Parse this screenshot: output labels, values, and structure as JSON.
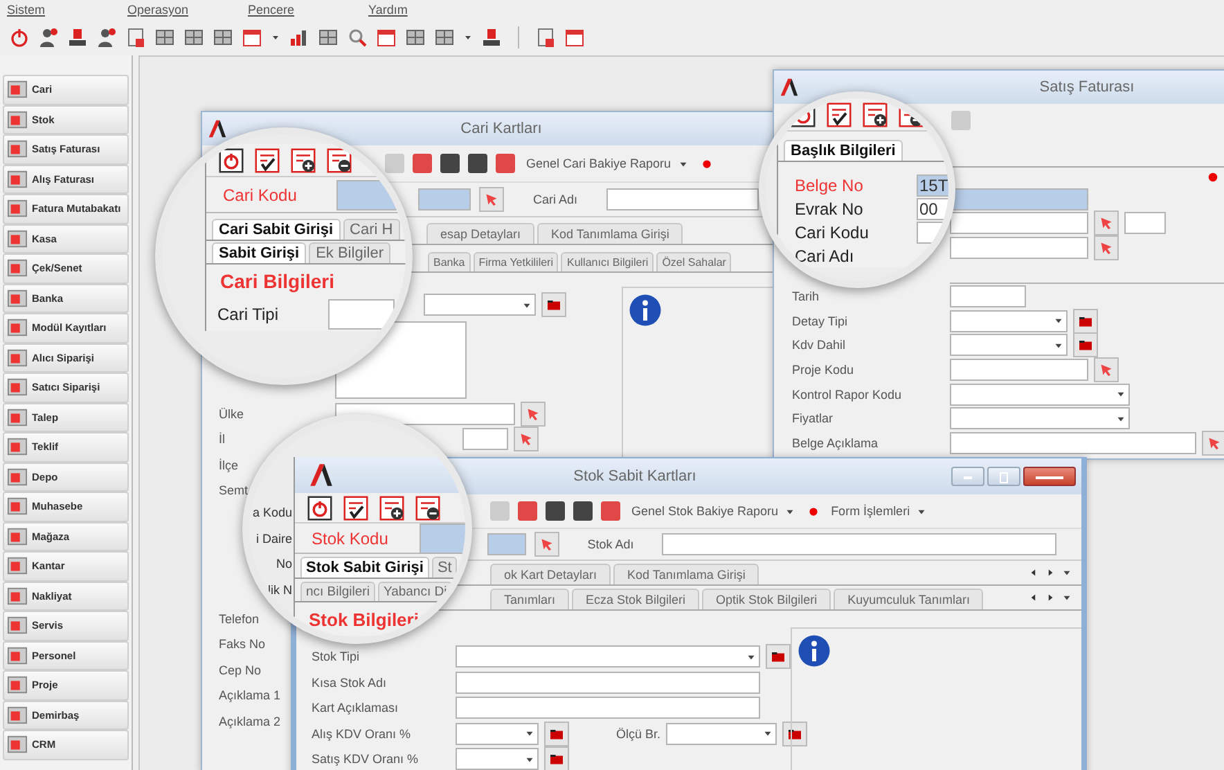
{
  "menu": [
    {
      "label": "Sistem"
    },
    {
      "label": "Operasyon"
    },
    {
      "label": "Pencere"
    },
    {
      "label": "Yardım"
    }
  ],
  "sidebar": {
    "items": [
      {
        "label": "Cari"
      },
      {
        "label": "Stok"
      },
      {
        "label": "Satış Faturası"
      },
      {
        "label": "Alış Faturası"
      },
      {
        "label": "Fatura Mutabakatı"
      },
      {
        "label": "Kasa"
      },
      {
        "label": "Çek/Senet"
      },
      {
        "label": "Banka"
      },
      {
        "label": "Modül Kayıtları"
      },
      {
        "label": "Alıcı Siparişi"
      },
      {
        "label": "Satıcı Siparişi"
      },
      {
        "label": "Talep"
      },
      {
        "label": "Teklif"
      },
      {
        "label": "Depo"
      },
      {
        "label": "Muhasebe"
      },
      {
        "label": "Mağaza"
      },
      {
        "label": "Kantar"
      },
      {
        "label": "Nakliyat"
      },
      {
        "label": "Servis"
      },
      {
        "label": "Personel"
      },
      {
        "label": "Proje"
      },
      {
        "label": "Demirbaş"
      },
      {
        "label": "CRM"
      }
    ]
  },
  "cari_window": {
    "title": "Cari Kartları",
    "report": "Genel Cari Bakiye Raporu",
    "name_label": "Cari Adı",
    "tabs": [
      {
        "label": "esap Detayları",
        "selected": false
      },
      {
        "label": "Kod Tanımlama Girişi",
        "selected": false
      }
    ],
    "subtabs": [
      {
        "label": "Banka",
        "selected": false
      },
      {
        "label": "Firma Yetkilileri",
        "selected": false
      },
      {
        "label": "Kullanıcı Bilgileri",
        "selected": false
      },
      {
        "label": "Özel Sahalar",
        "selected": false
      }
    ],
    "fields": [
      {
        "kind": "combo"
      },
      {
        "kind": "memo"
      },
      {
        "kind": "lookup",
        "label": "Ülke"
      },
      {
        "kind": "lookup",
        "label": "İl"
      },
      {
        "kind": "blank",
        "label": "İlçe"
      },
      {
        "kind": "blank",
        "label": "Semt"
      },
      {
        "kind": "blank"
      },
      {
        "kind": "blank"
      },
      {
        "kind": "blank"
      },
      {
        "kind": "blank"
      },
      {
        "kind": "blank",
        "label": "Telefon"
      },
      {
        "kind": "blank",
        "label": "Faks No"
      },
      {
        "kind": "blank",
        "label": "Cep No"
      },
      {
        "kind": "blank",
        "label": "Açıklama 1"
      },
      {
        "kind": "blank",
        "label": "Açıklama 2"
      }
    ]
  },
  "satis_window": {
    "title": "Satış Faturası",
    "fields": [
      {
        "kind": "blue"
      },
      {
        "kind": "pair"
      },
      {
        "kind": "lookup"
      },
      {
        "kind": "line"
      },
      {
        "kind": "date",
        "label": "Tarih"
      },
      {
        "kind": "combo",
        "label": "Detay Tipi"
      },
      {
        "kind": "combo",
        "label": "Kdv Dahil"
      },
      {
        "kind": "lookup",
        "label": "Proje Kodu"
      },
      {
        "kind": "wide",
        "label": "Kontrol Rapor Kodu"
      },
      {
        "kind": "wide",
        "label": "Fiyatlar"
      },
      {
        "kind": "note",
        "label": "Belge Açıklama"
      }
    ]
  },
  "stok_window": {
    "title": "Stok Sabit Kartları",
    "report": "Genel Stok Bakiye Raporu",
    "forms": "Form İşlemleri",
    "name_label": "Stok Adı",
    "tabs": [
      {
        "label": "ok Kart Detayları",
        "selected": false
      },
      {
        "label": "Kod Tanımlama Girişi",
        "selected": false
      }
    ],
    "subtabs": [
      {
        "label": "Tanımları",
        "selected": false
      },
      {
        "label": "Ecza Stok Bilgileri",
        "selected": false
      },
      {
        "label": "Optik Stok Bilgileri",
        "selected": false
      },
      {
        "label": "Kuyumculuk Tanımları",
        "selected": false
      }
    ],
    "fields": [
      {
        "kind": "combo",
        "label": "Stok Tipi"
      },
      {
        "kind": "text",
        "label": "Kısa Stok Adı"
      },
      {
        "kind": "text",
        "label": "Kart Açıklaması"
      },
      {
        "kind": "short",
        "label": "Alış KDV Oranı %",
        "extra": "Ölçü Br."
      },
      {
        "kind": "short",
        "label": "Satış KDV Oranı %"
      }
    ]
  },
  "magnifiers": [
    {
      "kind": "cari",
      "code_label": "Cari Kodu",
      "tabs": [
        {
          "label": "Cari Sabit Girişi",
          "selected": true
        },
        {
          "label": "Cari H",
          "selected": false
        }
      ],
      "subtabs": [
        {
          "label": "Sabit Girişi",
          "selected": true
        },
        {
          "label": "Ek Bilgiler",
          "selected": false
        }
      ],
      "heading": "Cari Bilgileri",
      "fields": [
        {
          "label": "Cari Tipi",
          "required": false
        }
      ]
    },
    {
      "kind": "satis",
      "tabs": [
        {
          "label": "Başlık Bilgileri",
          "selected": true
        }
      ],
      "fields": [
        {
          "label": "Belge No",
          "required": true,
          "value": "15T"
        },
        {
          "label": "Evrak No",
          "required": false,
          "value": "00"
        },
        {
          "label": "Cari Kodu",
          "required": false
        },
        {
          "label": "Cari Adı",
          "required": false
        }
      ]
    },
    {
      "kind": "stok",
      "side_labels": [
        {
          "label": "a Kodu"
        },
        {
          "label": "i Daire"
        },
        {
          "label": "No"
        },
        {
          "label": "lik N"
        }
      ],
      "code_label": "Stok Kodu",
      "tabs": [
        {
          "label": "Stok Sabit Girişi",
          "selected": true
        },
        {
          "label": "St",
          "selected": false
        }
      ],
      "subtabs": [
        {
          "label": "ncı Bilgileri",
          "selected": false
        },
        {
          "label": "Yabancı Di",
          "selected": false
        }
      ],
      "heading": "Stok Bilgileri"
    }
  ]
}
